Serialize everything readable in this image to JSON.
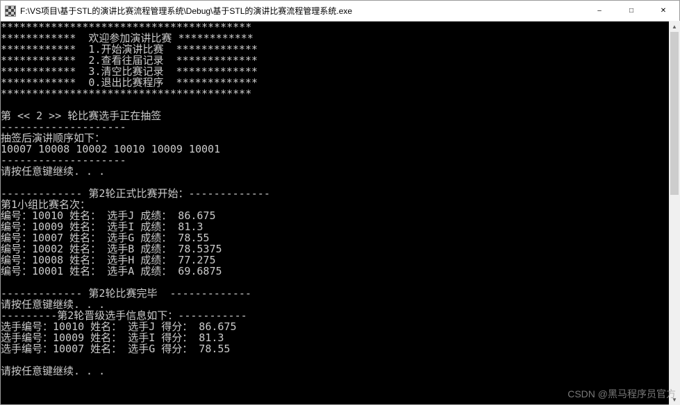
{
  "window": {
    "title": "F:\\VS项目\\基于STL的演讲比赛流程管理系统\\Debug\\基于STL的演讲比赛流程管理系统.exe"
  },
  "menu": {
    "border_top": "****************************************",
    "welcome": "************  欢迎参加演讲比赛 ************",
    "opt1": "************  1.开始演讲比赛  *************",
    "opt2": "************  2.查看往届记录  *************",
    "opt3": "************  3.清空比赛记录  *************",
    "opt0": "************  0.退出比赛程序  *************",
    "border_bot": "****************************************"
  },
  "draw": {
    "title": "第 << 2 >> 轮比赛选手正在抽签",
    "sep": "--------------------",
    "order_title": "抽签后演讲顺序如下：",
    "order": "10007 10008 10002 10010 10009 10001"
  },
  "pause": "请按任意键继续. . .",
  "round2_start": "------------- 第2轮正式比赛开始：------------- ",
  "group_heading": "第1小组比赛名次：",
  "results": [
    {
      "line": "编号：10010 姓名： 选手J 成绩： 86.675"
    },
    {
      "line": "编号：10009 姓名： 选手I 成绩： 81.3"
    },
    {
      "line": "编号：10007 姓名： 选手G 成绩： 78.55"
    },
    {
      "line": "编号：10002 姓名： 选手B 成绩： 78.5375"
    },
    {
      "line": "编号：10008 姓名： 选手H 成绩： 77.275"
    },
    {
      "line": "编号：10001 姓名： 选手A 成绩： 69.6875"
    }
  ],
  "round2_end": "------------- 第2轮比赛完毕  ------------- ",
  "promo_heading": "---------第2轮晋级选手信息如下：-----------",
  "promoted": [
    {
      "line": "选手编号：10010 姓名： 选手J 得分： 86.675"
    },
    {
      "line": "选手编号：10009 姓名： 选手I 得分： 81.3"
    },
    {
      "line": "选手编号：10007 姓名： 选手G 得分： 78.55"
    }
  ],
  "watermark": "CSDN @黑马程序员官方"
}
